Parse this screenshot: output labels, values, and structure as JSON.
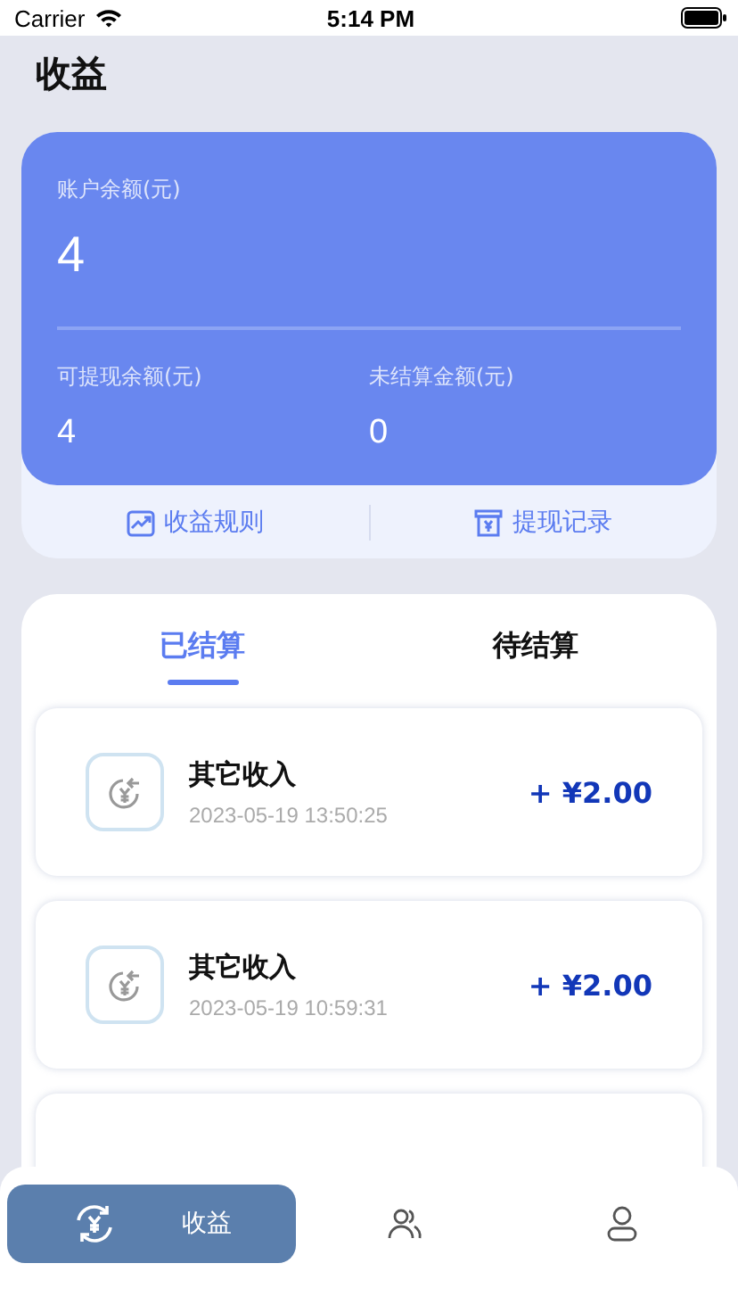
{
  "status_bar": {
    "carrier": "Carrier",
    "time": "5:14 PM"
  },
  "title": "收益",
  "balance_card": {
    "label": "账户余额(元)",
    "value": "4",
    "stats": [
      {
        "label": "可提现余额(元)",
        "value": "4"
      },
      {
        "label": "未结算金额(元)",
        "value": "0"
      }
    ]
  },
  "links": [
    {
      "label": "收益规则"
    },
    {
      "label": "提现记录"
    }
  ],
  "tabs": [
    {
      "label": "已结算",
      "selected": true
    },
    {
      "label": "待结算",
      "selected": false
    }
  ],
  "records": [
    {
      "title": "其它收入",
      "time": "2023-05-19 13:50:25",
      "amount": "+ ¥2.00"
    },
    {
      "title": "其它收入",
      "time": "2023-05-19 10:59:31",
      "amount": "+ ¥2.00"
    }
  ],
  "tab_bar": [
    {
      "label": "收益",
      "selected": true
    },
    {
      "selected": false
    },
    {
      "selected": false
    }
  ]
}
